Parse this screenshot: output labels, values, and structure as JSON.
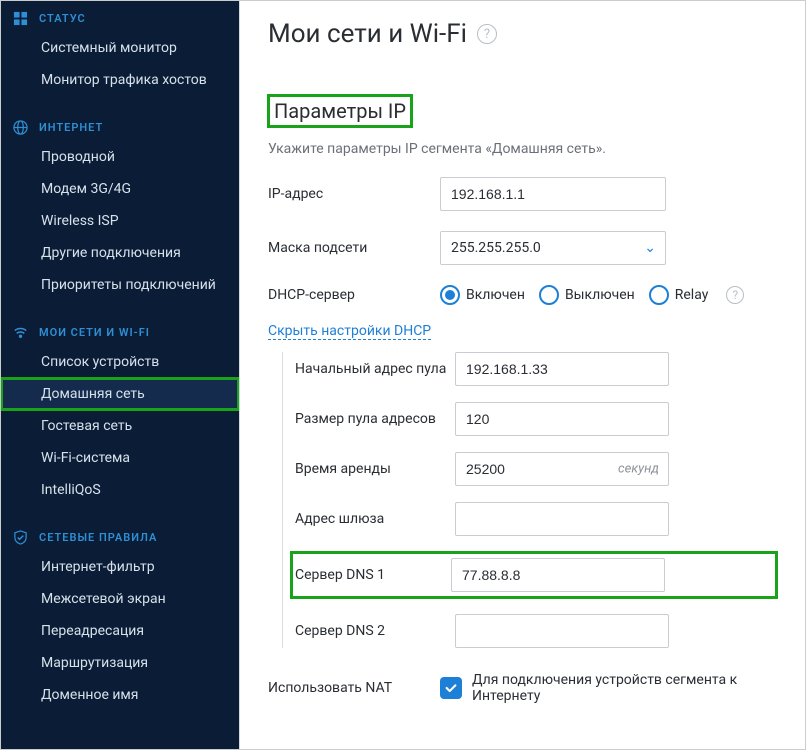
{
  "sidebar": {
    "status": {
      "header": "СТАТУС",
      "items": [
        "Системный монитор",
        "Монитор трафика хостов"
      ]
    },
    "internet": {
      "header": "ИНТЕРНЕТ",
      "items": [
        "Проводной",
        "Модем 3G/4G",
        "Wireless ISP",
        "Другие подключения",
        "Приоритеты подключений"
      ]
    },
    "networks": {
      "header": "МОИ СЕТИ И WI-FI",
      "items": [
        "Список устройств",
        "Домашняя сеть",
        "Гостевая сеть",
        "Wi-Fi-система",
        "IntelliQoS"
      ],
      "active_index": 1
    },
    "rules": {
      "header": "СЕТЕВЫЕ ПРАВИЛА",
      "items": [
        "Интернет-фильтр",
        "Межсетевой экран",
        "Переадресация",
        "Маршрутизация",
        "Доменное имя"
      ]
    }
  },
  "page": {
    "title": "Мои сети и Wi-Fi"
  },
  "section": {
    "title": "Параметры IP",
    "desc": "Укажите параметры IP сегмента «Домашняя сеть»."
  },
  "fields": {
    "ip_label": "IP-адрес",
    "ip_value": "192.168.1.1",
    "mask_label": "Маска подсети",
    "mask_value": "255.255.255.0",
    "dhcp_label": "DHCP-сервер",
    "dhcp_options": {
      "on": "Включен",
      "off": "Выключен",
      "relay": "Relay"
    },
    "dhcp_selected": "on",
    "collapse_label": "Скрыть настройки DHCP"
  },
  "dhcp": {
    "start_label": "Начальный адрес пула",
    "start_value": "192.168.1.33",
    "size_label": "Размер пула адресов",
    "size_value": "120",
    "lease_label": "Время аренды",
    "lease_value": "25200",
    "lease_suffix": "секунд",
    "gateway_label": "Адрес шлюза",
    "gateway_value": "",
    "dns1_label": "Сервер DNS 1",
    "dns1_value": "77.88.8.8",
    "dns2_label": "Сервер DNS 2",
    "dns2_value": ""
  },
  "nat": {
    "label": "Использовать NAT",
    "checked": true,
    "desc": "Для подключения устройств сегмента к Интернету"
  }
}
